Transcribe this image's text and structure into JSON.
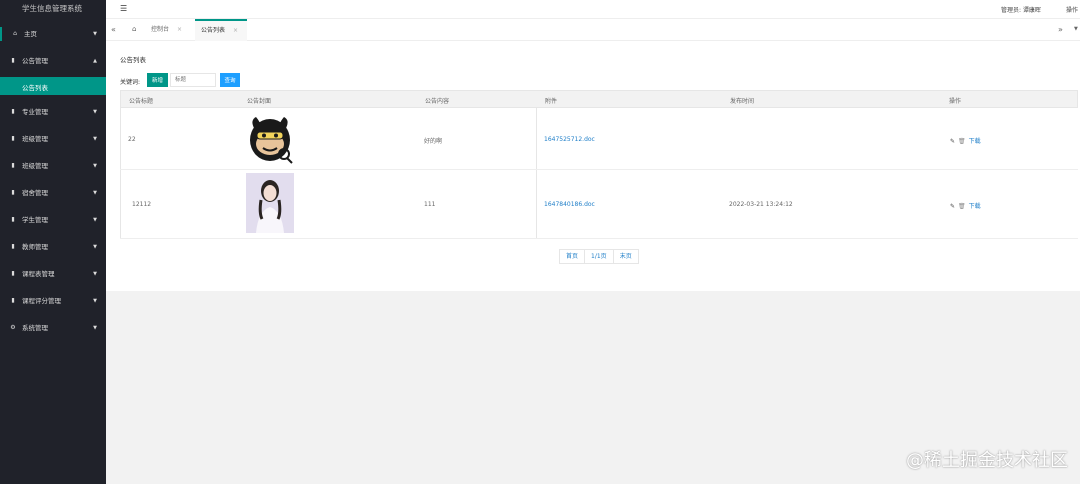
{
  "app": {
    "title": "学生信息管理系统"
  },
  "sidebar": {
    "items": [
      {
        "label": "主页",
        "icon": "home-icon"
      },
      {
        "label": "公告管理",
        "icon": "bar-chart-icon",
        "expanded": true
      },
      {
        "label": "专业管理",
        "icon": "bar-chart-icon"
      },
      {
        "label": "班级管理",
        "icon": "bar-chart-icon"
      },
      {
        "label": "班级管理",
        "icon": "bar-chart-icon"
      },
      {
        "label": "宿舍管理",
        "icon": "bar-chart-icon"
      },
      {
        "label": "学生管理",
        "icon": "bar-chart-icon"
      },
      {
        "label": "教师管理",
        "icon": "bar-chart-icon"
      },
      {
        "label": "课程表管理",
        "icon": "bar-chart-icon"
      },
      {
        "label": "课程评分管理",
        "icon": "bar-chart-icon"
      },
      {
        "label": "系统管理",
        "icon": "gear-icon"
      }
    ],
    "sub_item": "公告列表"
  },
  "header": {
    "admin": "管理员: 谭康晖",
    "ops": "操作"
  },
  "tabs": [
    {
      "label": "控制台"
    },
    {
      "label": "公告列表",
      "active": true
    }
  ],
  "main": {
    "title": "公告列表",
    "keyword_label": "关键词:",
    "add_button": "新增",
    "search_placeholder": "标题",
    "query_button": "查询",
    "columns": [
      "公告标题",
      "公告封面",
      "公告内容",
      "附件",
      "发布时间",
      "操作"
    ],
    "rows": [
      {
        "title": "22",
        "content": "好的啊",
        "attachment": "1647525712.doc",
        "time": "",
        "download": "下载"
      },
      {
        "title": "12112",
        "content": "111",
        "attachment": "1647840186.doc",
        "time": "2022-03-21 13:24:12",
        "download": "下载"
      }
    ]
  },
  "pager": {
    "first": "首页",
    "page": "1/1页",
    "last": "末页"
  },
  "watermark": "@稀土掘金技术社区",
  "colors": {
    "sidebar_bg": "#20222a",
    "accent": "#009688",
    "blue": "#1e9fff"
  }
}
